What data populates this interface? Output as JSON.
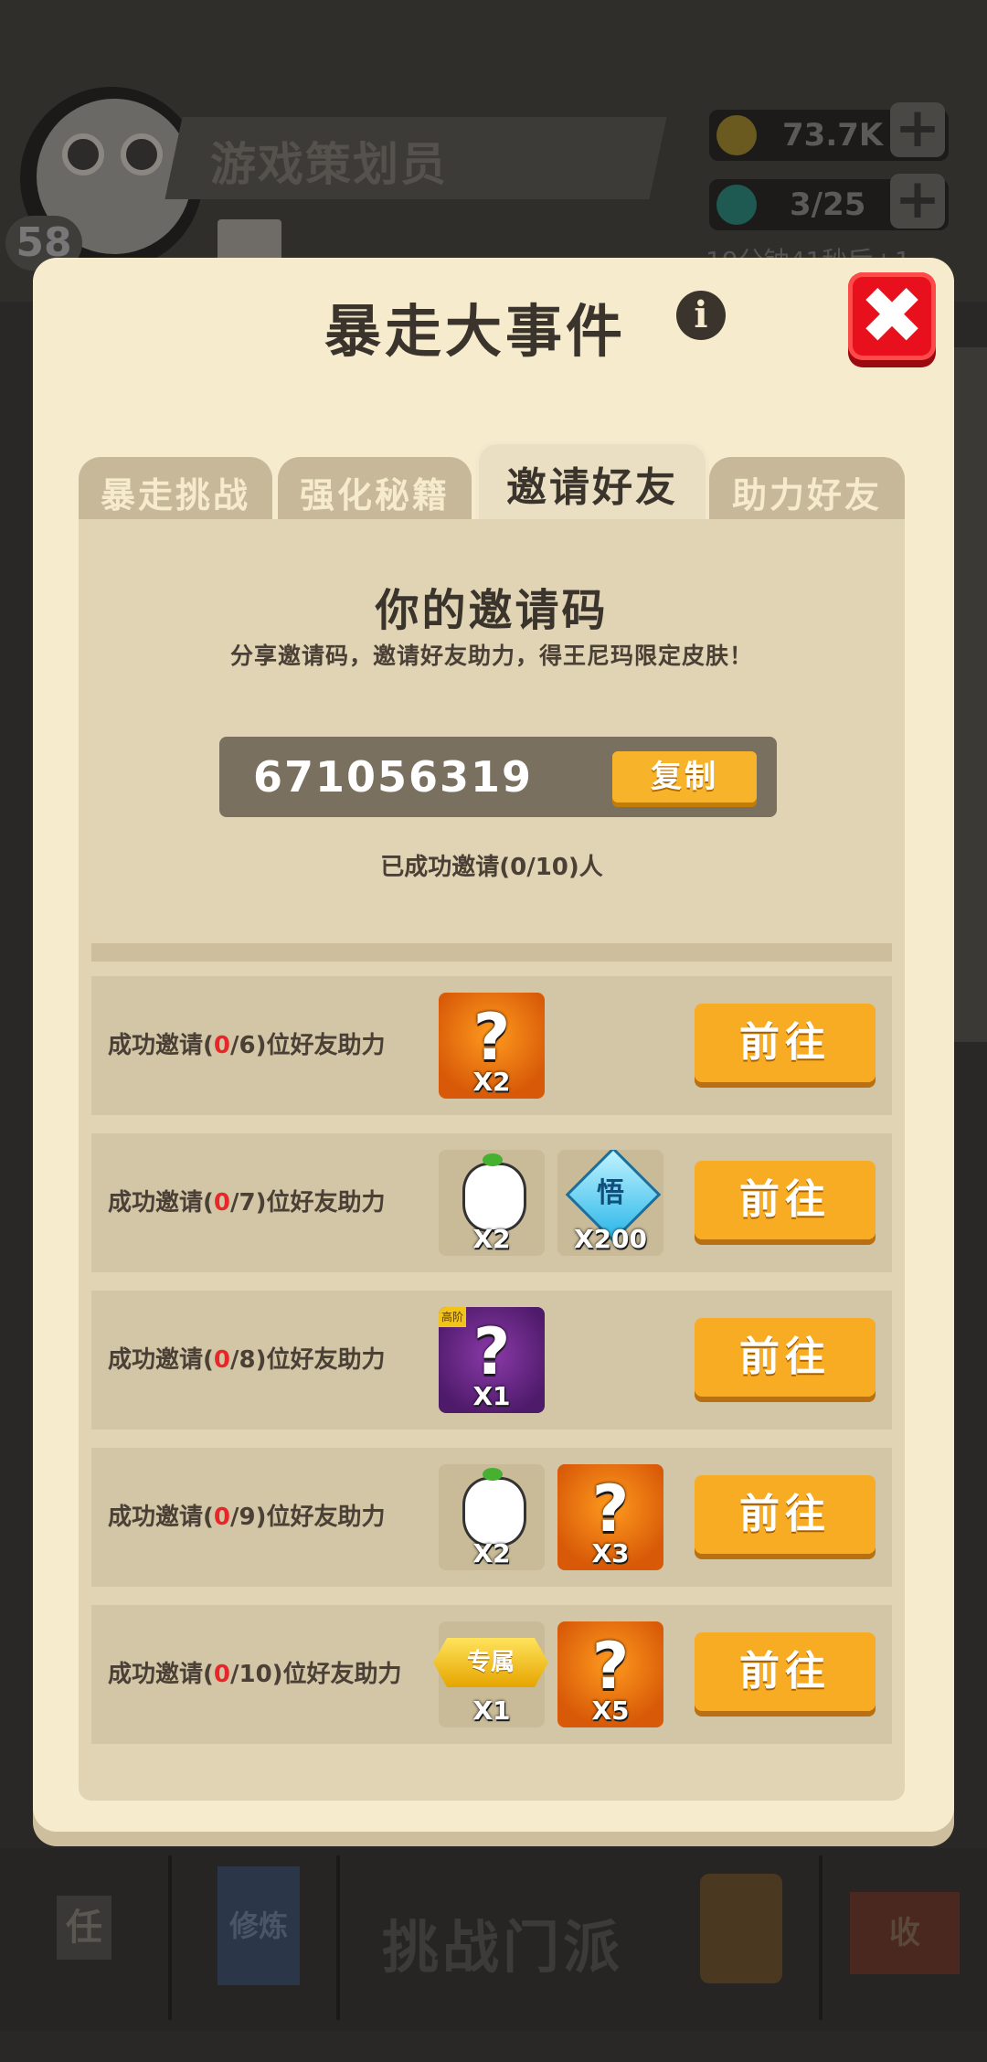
{
  "background": {
    "player_name": "游戏策划员",
    "level": "58",
    "gold": "73.7K",
    "energy": "3/25",
    "timer": "19分钟41秒后+1",
    "nav_center": "挑战门派",
    "nav_left_1": "任",
    "nav_left_2": "修炼",
    "nav_right_2": "收"
  },
  "modal": {
    "title": "暴走大事件",
    "info_icon": "i",
    "close_icon": "✖",
    "tabs": [
      {
        "label": "暴走挑战",
        "active": false
      },
      {
        "label": "强化秘籍",
        "active": false
      },
      {
        "label": "邀请好友",
        "active": true
      },
      {
        "label": "助力好友",
        "active": false
      }
    ],
    "invite": {
      "title": "你的邀请码",
      "subtitle": "分享邀请码，邀请好友助力，得王尼玛限定皮肤！",
      "code": "671056319",
      "copy_label": "复制",
      "success_text": "已成功邀请(0/10)人"
    },
    "tasks": [
      {
        "prefix": "成功邀请(",
        "done": "0",
        "suffix": "/6)位好友助力",
        "rewards": [
          {
            "type": "mystery-shirt",
            "qty": "X2"
          }
        ],
        "button": "前往"
      },
      {
        "prefix": "成功邀请(",
        "done": "0",
        "suffix": "/7)位好友助力",
        "rewards": [
          {
            "type": "character-fragment",
            "qty": "X2"
          },
          {
            "type": "wu-gem",
            "label": "悟",
            "qty": "X200"
          }
        ],
        "button": "前往"
      },
      {
        "prefix": "成功邀请(",
        "done": "0",
        "suffix": "/8)位好友助力",
        "rewards": [
          {
            "type": "mystery-advanced",
            "tag": "高阶",
            "qty": "X1"
          }
        ],
        "button": "前往"
      },
      {
        "prefix": "成功邀请(",
        "done": "0",
        "suffix": "/9)位好友助力",
        "rewards": [
          {
            "type": "character-fragment",
            "qty": "X2"
          },
          {
            "type": "mystery-shirt",
            "qty": "X3"
          }
        ],
        "button": "前往"
      },
      {
        "prefix": "成功邀请(",
        "done": "0",
        "suffix": "/10)位好友助力",
        "rewards": [
          {
            "type": "exclusive-badge",
            "label": "专属",
            "qty": "X1"
          },
          {
            "type": "mystery-weapon",
            "qty": "X5"
          }
        ],
        "button": "前往"
      }
    ]
  },
  "colors": {
    "modal_bg": "#f6ebcd",
    "button_orange": "#f7ac24",
    "close_red": "#e8101c",
    "highlight_red": "#e8262a"
  }
}
